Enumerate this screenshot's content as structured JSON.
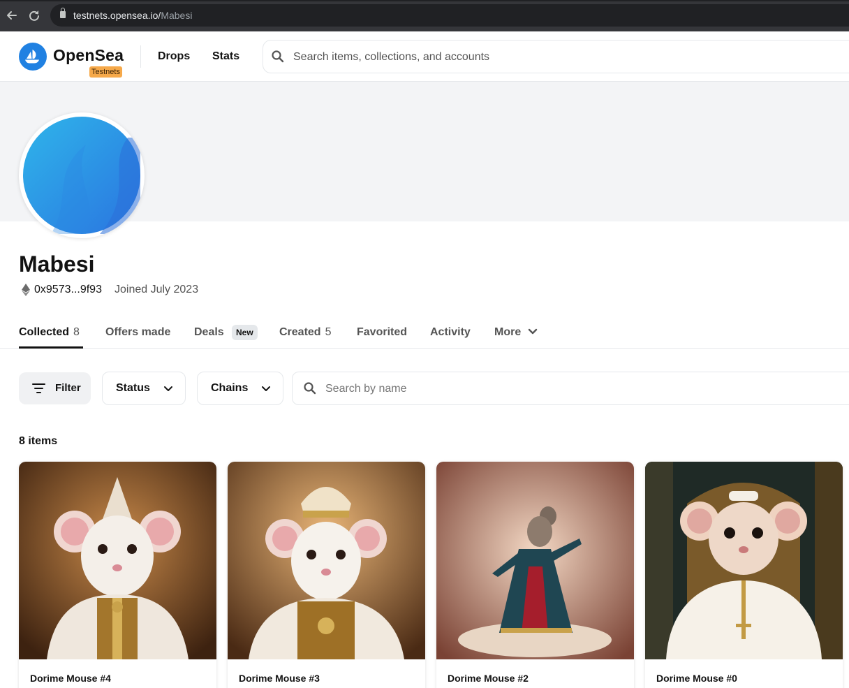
{
  "browser": {
    "url_host": "testnets.opensea.io/",
    "url_path": "Mabesi"
  },
  "header": {
    "brand": "OpenSea",
    "env_badge": "Testnets",
    "nav": [
      {
        "label": "Drops"
      },
      {
        "label": "Stats"
      }
    ],
    "search_placeholder": "Search items, collections, and accounts"
  },
  "profile": {
    "name": "Mabesi",
    "address": "0x9573...9f93",
    "joined": "Joined July 2023"
  },
  "tabs": [
    {
      "label": "Collected",
      "count": "8",
      "active": true
    },
    {
      "label": "Offers made"
    },
    {
      "label": "Deals",
      "badge": "New"
    },
    {
      "label": "Created",
      "count": "5"
    },
    {
      "label": "Favorited"
    },
    {
      "label": "Activity"
    },
    {
      "label": "More"
    }
  ],
  "toolbar": {
    "filter_label": "Filter",
    "status_label": "Status",
    "chains_label": "Chains",
    "name_search_placeholder": "Search by name"
  },
  "items_count": "8 items",
  "items": [
    {
      "name": "Dorime Mouse #4",
      "palette": [
        "#6b3f1e",
        "#f2e6d8",
        "#c99a3b"
      ]
    },
    {
      "name": "Dorime Mouse #3",
      "palette": [
        "#8a5a2b",
        "#f4ece2",
        "#caa14a"
      ]
    },
    {
      "name": "Dorime Mouse #2",
      "palette": [
        "#d9a28a",
        "#2a4a52",
        "#a01d2a"
      ]
    },
    {
      "name": "Dorime Mouse #0",
      "palette": [
        "#1d2a2a",
        "#f3efe6",
        "#c29a44"
      ]
    }
  ],
  "colors": {
    "brand_blue": "#2081e2",
    "testnets_orange": "#f6a94a"
  },
  "icons": [
    "back-arrow-icon",
    "reload-icon",
    "lock-icon",
    "opensea-logo-icon",
    "search-icon",
    "ethereum-icon",
    "filter-icon",
    "chevron-down-icon"
  ]
}
